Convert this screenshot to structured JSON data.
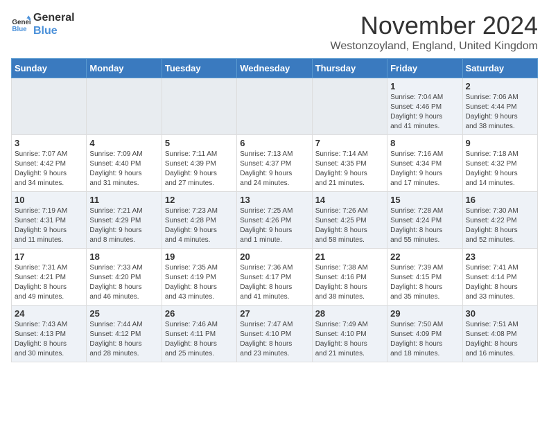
{
  "logo": {
    "line1": "General",
    "line2": "Blue"
  },
  "title": "November 2024",
  "location": "Westonzoyland, England, United Kingdom",
  "weekdays": [
    "Sunday",
    "Monday",
    "Tuesday",
    "Wednesday",
    "Thursday",
    "Friday",
    "Saturday"
  ],
  "weeks": [
    [
      {
        "day": "",
        "info": ""
      },
      {
        "day": "",
        "info": ""
      },
      {
        "day": "",
        "info": ""
      },
      {
        "day": "",
        "info": ""
      },
      {
        "day": "",
        "info": ""
      },
      {
        "day": "1",
        "info": "Sunrise: 7:04 AM\nSunset: 4:46 PM\nDaylight: 9 hours\nand 41 minutes."
      },
      {
        "day": "2",
        "info": "Sunrise: 7:06 AM\nSunset: 4:44 PM\nDaylight: 9 hours\nand 38 minutes."
      }
    ],
    [
      {
        "day": "3",
        "info": "Sunrise: 7:07 AM\nSunset: 4:42 PM\nDaylight: 9 hours\nand 34 minutes."
      },
      {
        "day": "4",
        "info": "Sunrise: 7:09 AM\nSunset: 4:40 PM\nDaylight: 9 hours\nand 31 minutes."
      },
      {
        "day": "5",
        "info": "Sunrise: 7:11 AM\nSunset: 4:39 PM\nDaylight: 9 hours\nand 27 minutes."
      },
      {
        "day": "6",
        "info": "Sunrise: 7:13 AM\nSunset: 4:37 PM\nDaylight: 9 hours\nand 24 minutes."
      },
      {
        "day": "7",
        "info": "Sunrise: 7:14 AM\nSunset: 4:35 PM\nDaylight: 9 hours\nand 21 minutes."
      },
      {
        "day": "8",
        "info": "Sunrise: 7:16 AM\nSunset: 4:34 PM\nDaylight: 9 hours\nand 17 minutes."
      },
      {
        "day": "9",
        "info": "Sunrise: 7:18 AM\nSunset: 4:32 PM\nDaylight: 9 hours\nand 14 minutes."
      }
    ],
    [
      {
        "day": "10",
        "info": "Sunrise: 7:19 AM\nSunset: 4:31 PM\nDaylight: 9 hours\nand 11 minutes."
      },
      {
        "day": "11",
        "info": "Sunrise: 7:21 AM\nSunset: 4:29 PM\nDaylight: 9 hours\nand 8 minutes."
      },
      {
        "day": "12",
        "info": "Sunrise: 7:23 AM\nSunset: 4:28 PM\nDaylight: 9 hours\nand 4 minutes."
      },
      {
        "day": "13",
        "info": "Sunrise: 7:25 AM\nSunset: 4:26 PM\nDaylight: 9 hours\nand 1 minute."
      },
      {
        "day": "14",
        "info": "Sunrise: 7:26 AM\nSunset: 4:25 PM\nDaylight: 8 hours\nand 58 minutes."
      },
      {
        "day": "15",
        "info": "Sunrise: 7:28 AM\nSunset: 4:24 PM\nDaylight: 8 hours\nand 55 minutes."
      },
      {
        "day": "16",
        "info": "Sunrise: 7:30 AM\nSunset: 4:22 PM\nDaylight: 8 hours\nand 52 minutes."
      }
    ],
    [
      {
        "day": "17",
        "info": "Sunrise: 7:31 AM\nSunset: 4:21 PM\nDaylight: 8 hours\nand 49 minutes."
      },
      {
        "day": "18",
        "info": "Sunrise: 7:33 AM\nSunset: 4:20 PM\nDaylight: 8 hours\nand 46 minutes."
      },
      {
        "day": "19",
        "info": "Sunrise: 7:35 AM\nSunset: 4:19 PM\nDaylight: 8 hours\nand 43 minutes."
      },
      {
        "day": "20",
        "info": "Sunrise: 7:36 AM\nSunset: 4:17 PM\nDaylight: 8 hours\nand 41 minutes."
      },
      {
        "day": "21",
        "info": "Sunrise: 7:38 AM\nSunset: 4:16 PM\nDaylight: 8 hours\nand 38 minutes."
      },
      {
        "day": "22",
        "info": "Sunrise: 7:39 AM\nSunset: 4:15 PM\nDaylight: 8 hours\nand 35 minutes."
      },
      {
        "day": "23",
        "info": "Sunrise: 7:41 AM\nSunset: 4:14 PM\nDaylight: 8 hours\nand 33 minutes."
      }
    ],
    [
      {
        "day": "24",
        "info": "Sunrise: 7:43 AM\nSunset: 4:13 PM\nDaylight: 8 hours\nand 30 minutes."
      },
      {
        "day": "25",
        "info": "Sunrise: 7:44 AM\nSunset: 4:12 PM\nDaylight: 8 hours\nand 28 minutes."
      },
      {
        "day": "26",
        "info": "Sunrise: 7:46 AM\nSunset: 4:11 PM\nDaylight: 8 hours\nand 25 minutes."
      },
      {
        "day": "27",
        "info": "Sunrise: 7:47 AM\nSunset: 4:10 PM\nDaylight: 8 hours\nand 23 minutes."
      },
      {
        "day": "28",
        "info": "Sunrise: 7:49 AM\nSunset: 4:10 PM\nDaylight: 8 hours\nand 21 minutes."
      },
      {
        "day": "29",
        "info": "Sunrise: 7:50 AM\nSunset: 4:09 PM\nDaylight: 8 hours\nand 18 minutes."
      },
      {
        "day": "30",
        "info": "Sunrise: 7:51 AM\nSunset: 4:08 PM\nDaylight: 8 hours\nand 16 minutes."
      }
    ]
  ]
}
